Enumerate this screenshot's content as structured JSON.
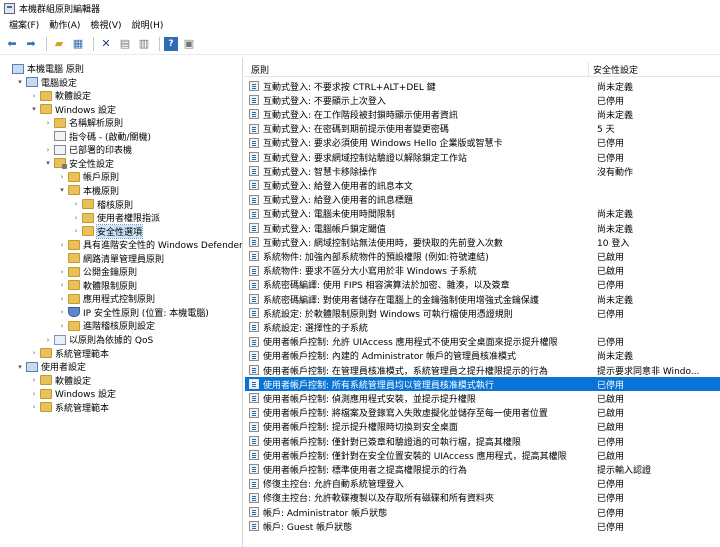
{
  "window": {
    "title": "本機群組原則編輯器"
  },
  "menu": [
    "檔案(F)",
    "動作(A)",
    "檢視(V)",
    "說明(H)"
  ],
  "toolbar": {
    "buttons": [
      "back-icon",
      "forward-icon",
      "up-folder-icon",
      "show-hide-tree-icon",
      "delete-icon",
      "properties-icon",
      "export-list-icon",
      "help-icon",
      "extended-view-icon"
    ]
  },
  "tree": [
    {
      "label": "本機電腦 原則",
      "indent": 0,
      "exp": "",
      "icon": "comp"
    },
    {
      "label": "電腦設定",
      "indent": 1,
      "exp": "▾",
      "icon": "comp"
    },
    {
      "label": "軟體設定",
      "indent": 2,
      "exp": "›",
      "icon": "folder"
    },
    {
      "label": "Windows 設定",
      "indent": 2,
      "exp": "▾",
      "icon": "folder"
    },
    {
      "label": "名稱解析原則",
      "indent": 3,
      "exp": "›",
      "icon": "folder"
    },
    {
      "label": "指令碼 - (啟動/關機)",
      "indent": 3,
      "exp": "",
      "icon": "policy"
    },
    {
      "label": "已部署的印表機",
      "indent": 3,
      "exp": "›",
      "icon": "policy"
    },
    {
      "label": "安全性設定",
      "indent": 3,
      "exp": "▾",
      "icon": "lock"
    },
    {
      "label": "帳戶原則",
      "indent": 4,
      "exp": "›",
      "icon": "folder"
    },
    {
      "label": "本機原則",
      "indent": 4,
      "exp": "▾",
      "icon": "folder"
    },
    {
      "label": "稽核原則",
      "indent": 5,
      "exp": "›",
      "icon": "folder"
    },
    {
      "label": "使用者權限指派",
      "indent": 5,
      "exp": "›",
      "icon": "folder"
    },
    {
      "label": "安全性選項",
      "indent": 5,
      "exp": "›",
      "icon": "folder",
      "selected": true
    },
    {
      "label": "具有進階安全性的 Windows Defender 防火牆",
      "indent": 4,
      "exp": "›",
      "icon": "folder"
    },
    {
      "label": "網路清單管理員原則",
      "indent": 4,
      "exp": "",
      "icon": "folder"
    },
    {
      "label": "公開金鑰原則",
      "indent": 4,
      "exp": "›",
      "icon": "folder"
    },
    {
      "label": "軟體限制原則",
      "indent": 4,
      "exp": "›",
      "icon": "folder"
    },
    {
      "label": "應用程式控制原則",
      "indent": 4,
      "exp": "›",
      "icon": "folder"
    },
    {
      "label": "IP 安全性原則 (位置: 本機電腦)",
      "indent": 4,
      "exp": "›",
      "icon": "shield"
    },
    {
      "label": "進階稽核原則設定",
      "indent": 4,
      "exp": "›",
      "icon": "folder"
    },
    {
      "label": "以原則為依據的 QoS",
      "indent": 3,
      "exp": "›",
      "icon": "chart"
    },
    {
      "label": "系統管理範本",
      "indent": 2,
      "exp": "›",
      "icon": "folder"
    },
    {
      "label": "使用者設定",
      "indent": 1,
      "exp": "▾",
      "icon": "comp"
    },
    {
      "label": "軟體設定",
      "indent": 2,
      "exp": "›",
      "icon": "folder"
    },
    {
      "label": "Windows 設定",
      "indent": 2,
      "exp": "›",
      "icon": "folder"
    },
    {
      "label": "系統管理範本",
      "indent": 2,
      "exp": "›",
      "icon": "folder"
    }
  ],
  "columns": {
    "policy": "原則",
    "setting": "安全性設定"
  },
  "rows": [
    {
      "name": "互動式登入: 不要求按 CTRL+ALT+DEL 鍵",
      "setting": "尚未定義"
    },
    {
      "name": "互動式登入: 不要顯示上次登入",
      "setting": "已停用"
    },
    {
      "name": "互動式登入: 在工作階段被封鎖時顯示使用者資訊",
      "setting": "尚未定義"
    },
    {
      "name": "互動式登入: 在密碼到期前提示使用者變更密碼",
      "setting": "5 天"
    },
    {
      "name": "互動式登入: 要求必須使用 Windows Hello 企業版或智慧卡",
      "setting": "已停用"
    },
    {
      "name": "互動式登入: 要求網域控制站驗證以解除鎖定工作站",
      "setting": "已停用"
    },
    {
      "name": "互動式登入: 智慧卡移除操作",
      "setting": "沒有動作"
    },
    {
      "name": "互動式登入: 給登入使用者的訊息本文",
      "setting": ""
    },
    {
      "name": "互動式登入: 給登入使用者的訊息標題",
      "setting": ""
    },
    {
      "name": "互動式登入: 電腦未使用時間限制",
      "setting": "尚未定義"
    },
    {
      "name": "互動式登入: 電腦帳戶鎖定閾值",
      "setting": "尚未定義"
    },
    {
      "name": "互動式登入: 網域控制站無法使用時，要快取的先前登入次數",
      "setting": "10 登入"
    },
    {
      "name": "系統物件: 加強內部系統物件的預設權限 (例如:符號連結)",
      "setting": "已啟用"
    },
    {
      "name": "系統物件: 要求不區分大小寫用於非 Windows 子系統",
      "setting": "已啟用"
    },
    {
      "name": "系統密碼編譯: 使用 FIPS 相容演算法於加密、雜湊，以及簽章",
      "setting": "已停用"
    },
    {
      "name": "系統密碼編譯: 對使用者儲存在電腦上的金鑰強制使用增強式金鑰保護",
      "setting": "尚未定義"
    },
    {
      "name": "系統設定: 於軟體限制原則對 Windows 可執行檔使用憑證規則",
      "setting": "已停用"
    },
    {
      "name": "系統設定: 選擇性的子系統",
      "setting": ""
    },
    {
      "name": "使用者帳戶控制: 允許 UIAccess 應用程式不使用安全桌面來提示提升權限",
      "setting": "已停用"
    },
    {
      "name": "使用者帳戶控制: 內建的 Administrator 帳戶的管理員核准模式",
      "setting": "尚未定義"
    },
    {
      "name": "使用者帳戶控制: 在管理員核准模式，系統管理員之提升權限提示的行為",
      "setting": "提示要求同意非 Windo..."
    },
    {
      "name": "使用者帳戶控制: 所有系統管理員均以管理員核准模式執行",
      "setting": "已停用",
      "selected": true
    },
    {
      "name": "使用者帳戶控制: 偵測應用程式安裝，並提示提升權限",
      "setting": "已啟用"
    },
    {
      "name": "使用者帳戶控制: 將檔案及登錄寫入失敗虛擬化並儲存至每一使用者位置",
      "setting": "已啟用"
    },
    {
      "name": "使用者帳戶控制: 提示提升權限時切換到安全桌面",
      "setting": "已啟用"
    },
    {
      "name": "使用者帳戶控制: 僅針對已簽章和驗證過的可執行檔，提高其權限",
      "setting": "已停用"
    },
    {
      "name": "使用者帳戶控制: 僅針對在安全位置安裝的 UIAccess 應用程式，提高其權限",
      "setting": "已啟用"
    },
    {
      "name": "使用者帳戶控制: 標準使用者之提高權限提示的行為",
      "setting": "提示輸入認證"
    },
    {
      "name": "修復主控台: 允許自動系統管理登入",
      "setting": "已停用"
    },
    {
      "name": "修復主控台: 允許軟碟複製以及存取所有磁碟和所有資料夾",
      "setting": "已停用"
    },
    {
      "name": "帳戶: Administrator 帳戶狀態",
      "setting": "已停用"
    },
    {
      "name": "帳戶: Guest 帳戶狀態",
      "setting": "已停用"
    }
  ]
}
